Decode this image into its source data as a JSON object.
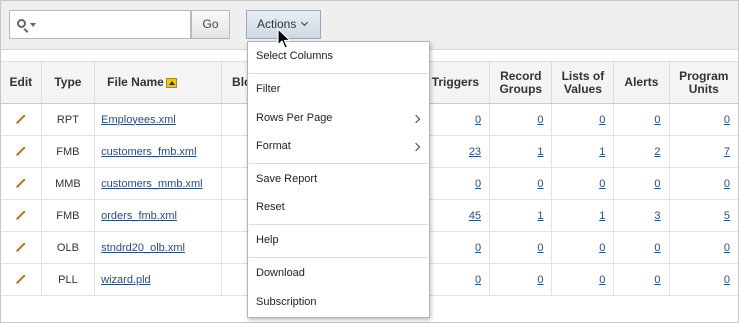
{
  "toolbar": {
    "search_value": "",
    "go_label": "Go",
    "actions_label": "Actions"
  },
  "table": {
    "headers": [
      "Edit",
      "Type",
      "File Name",
      "Bloc",
      "Triggers",
      "Record Groups",
      "Lists of Values",
      "Alerts",
      "Program Units"
    ],
    "rows": [
      {
        "type": "RPT",
        "file": "Employees.xml",
        "triggers": "0",
        "record_groups": "0",
        "lovs": "0",
        "alerts": "0",
        "program_units": "0"
      },
      {
        "type": "FMB",
        "file": "customers_fmb.xml",
        "triggers": "23",
        "record_groups": "1",
        "lovs": "1",
        "alerts": "2",
        "program_units": "7"
      },
      {
        "type": "MMB",
        "file": "customers_mmb.xml",
        "triggers": "0",
        "record_groups": "0",
        "lovs": "0",
        "alerts": "0",
        "program_units": "0"
      },
      {
        "type": "FMB",
        "file": "orders_fmb.xml",
        "triggers": "45",
        "record_groups": "1",
        "lovs": "1",
        "alerts": "3",
        "program_units": "5"
      },
      {
        "type": "OLB",
        "file": "stndrd20_olb.xml",
        "triggers": "0",
        "record_groups": "0",
        "lovs": "0",
        "alerts": "0",
        "program_units": "0"
      },
      {
        "type": "PLL",
        "file": "wizard.pld",
        "triggers": "0",
        "record_groups": "0",
        "lovs": "0",
        "alerts": "0",
        "program_units": "0"
      }
    ]
  },
  "menu": {
    "select_columns": "Select Columns",
    "filter": "Filter",
    "rows_per_page": "Rows Per Page",
    "format": "Format",
    "save_report": "Save Report",
    "reset": "Reset",
    "help": "Help",
    "download": "Download",
    "subscription": "Subscription"
  },
  "icons": {
    "search": "search-icon",
    "edit": "pencil-icon",
    "sort": "sort-ascending-icon",
    "submenu": "chevron-right-icon",
    "cursor": "mouse-pointer-icon"
  },
  "colors": {
    "link": "#2b4c77",
    "actions_button": "#cfd9e4",
    "sort_icon": "#f0c419"
  }
}
